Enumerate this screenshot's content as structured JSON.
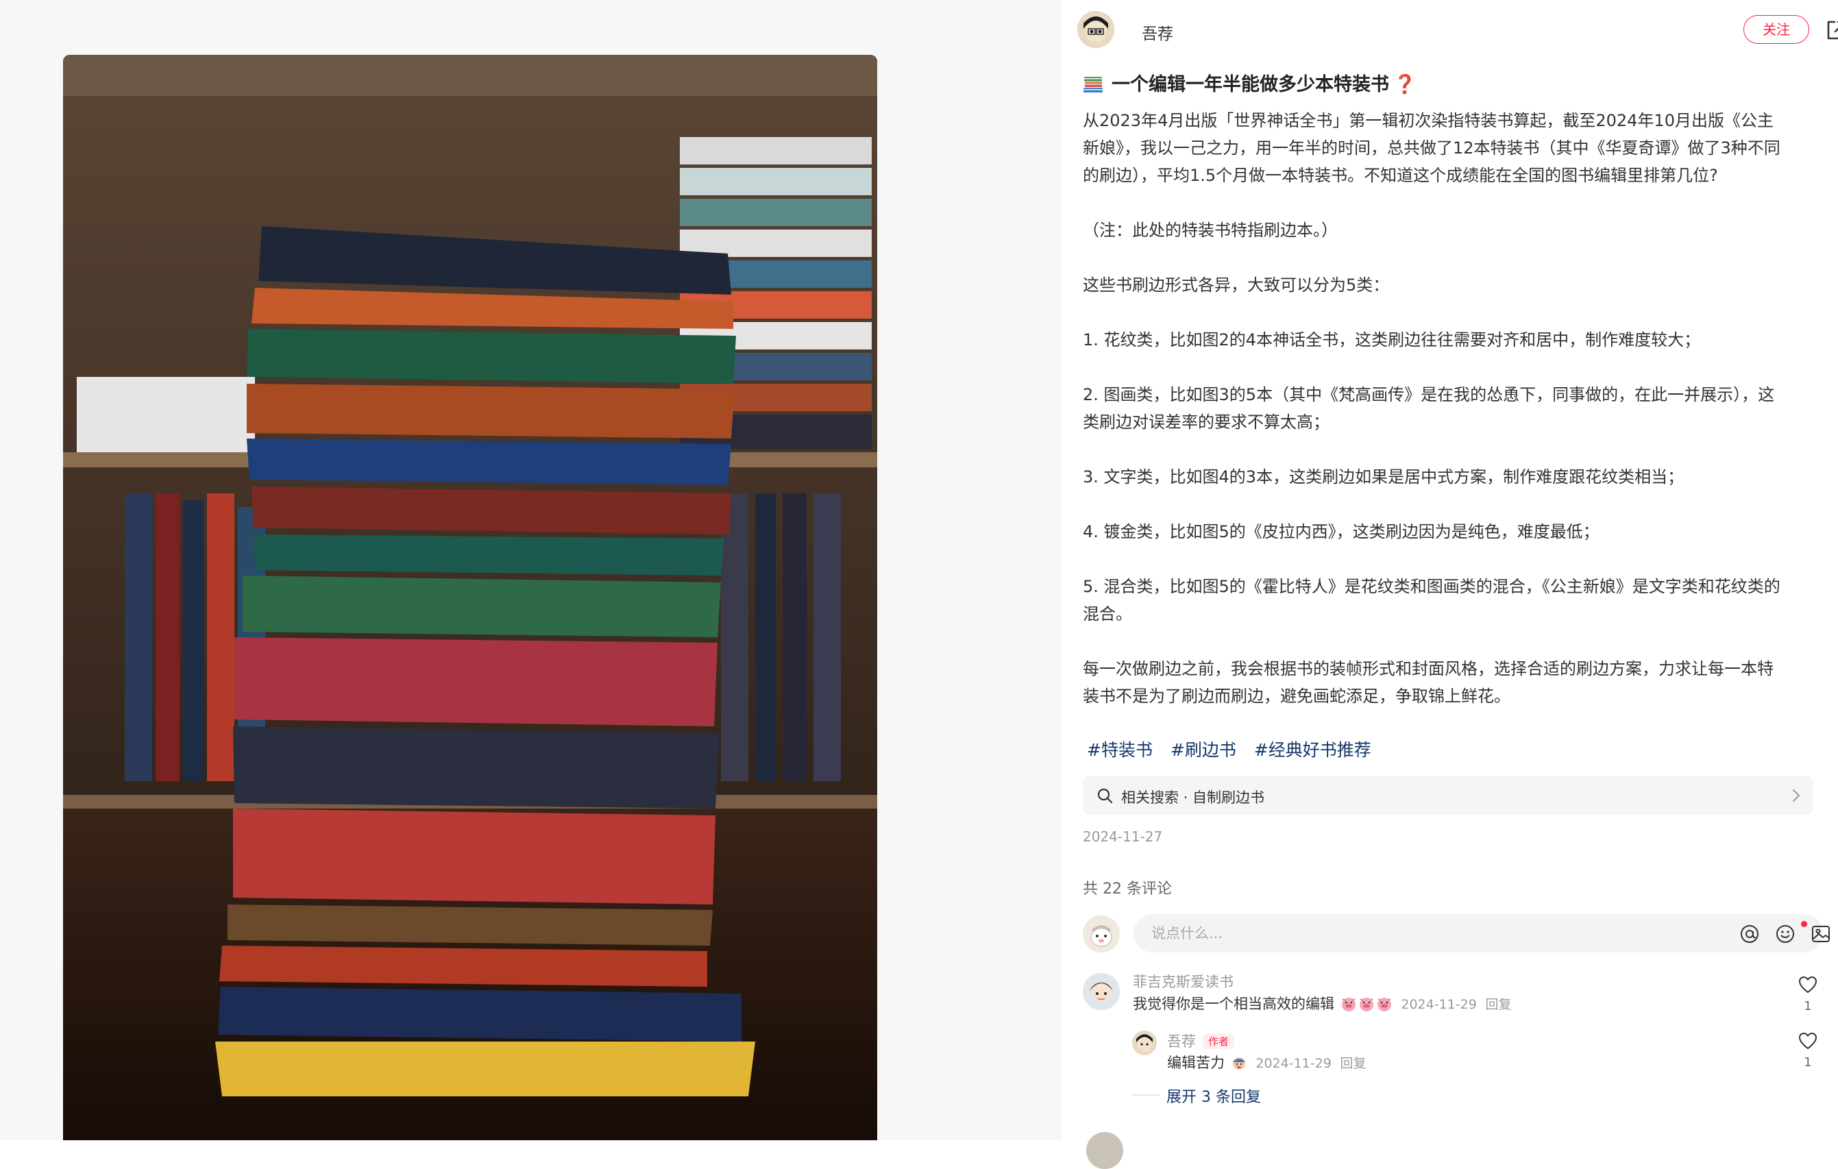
{
  "author": {
    "name": "吾荐",
    "follow_label": "关注"
  },
  "note": {
    "title": "一个编辑一年半能做多少本特装书",
    "title_emoji": "❓",
    "paragraphs": [
      "从2023年4月出版「世界神话全书」第一辑初次染指特装书算起，截至2024年10月出版《公主新娘》，我以一己之力，用一年半的时间，总共做了12本特装书（其中《华夏奇谭》做了3种不同的刷边），平均1.5个月做一本特装书。不知道这个成绩能在全国的图书编辑里排第几位?",
      "（注：此处的特装书特指刷边本。）",
      "这些书刷边形式各异，大致可以分为5类：",
      "1. 花纹类，比如图2的4本神话全书，这类刷边往往需要对齐和居中，制作难度较大；",
      "2. 图画类，比如图3的5本（其中《梵高画传》是在我的怂恿下，同事做的，在此一并展示），这类刷边对误差率的要求不算太高；",
      "3. 文字类，比如图4的3本，这类刷边如果是居中式方案，制作难度跟花纹类相当；",
      "4. 镀金类，比如图5的《皮拉内西》，这类刷边因为是纯色，难度最低；",
      "5. 混合类，比如图5的《霍比特人》是花纹类和图画类的混合，《公主新娘》是文字类和花纹类的混合。",
      "每一次做刷边之前，我会根据书的装帧形式和封面风格，选择合适的刷边方案，力求让每一本特装书不是为了刷边而刷边，避免画蛇添足，争取锦上鲜花。"
    ],
    "tags": [
      "#特装书",
      "#刷边书",
      "#经典好书推荐"
    ],
    "related_search": "相关搜索 · 自制刷边书",
    "date": "2024-11-27"
  },
  "comments_section": {
    "count_label": "共 22 条评论",
    "input_placeholder": "说点什么...",
    "comments": [
      {
        "user": "菲吉克斯爱读书",
        "text": "我觉得你是一个相当高效的编辑",
        "date": "2024-11-29",
        "reply_label": "回复",
        "likes": "1"
      }
    ],
    "replies": [
      {
        "user": "吾荐",
        "badge": "作者",
        "text": "编辑苦力",
        "date": "2024-11-29",
        "reply_label": "回复",
        "likes": "1"
      }
    ],
    "expand_label": "展开 3 条回复"
  },
  "colors": {
    "accent": "#ff2442",
    "tag": "#13386c",
    "muted": "#999999"
  },
  "icons": {
    "share": "share-icon",
    "search": "search-icon",
    "at": "at-icon",
    "emoji": "emoji-icon",
    "image": "image-icon",
    "like": "heart-icon"
  }
}
